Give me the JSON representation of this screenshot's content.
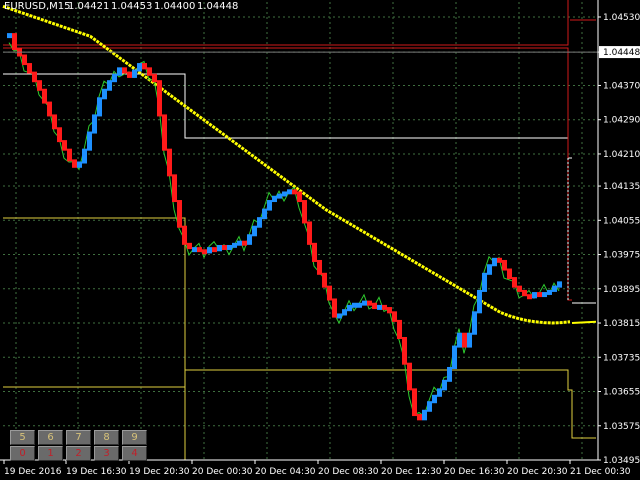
{
  "title": {
    "symbol_tf": "EURUSD,M15",
    "bid": "1.04421",
    "high": "1.04453",
    "low": "1.04400",
    "close": "1.04448"
  },
  "price_scale": {
    "ticks": [
      "1.04530",
      "1.04448",
      "1.04370",
      "1.04290",
      "1.04210",
      "1.04135",
      "1.04055",
      "1.03975",
      "1.03895",
      "1.03815",
      "1.03735",
      "1.03655",
      "1.03575",
      "1.03495"
    ],
    "current_price": "1.04448",
    "current_price_color": "#ffffff"
  },
  "time_scale": {
    "ticks": [
      "19 Dec 2016",
      "19 Dec 16:30",
      "19 Dec 20:30",
      "20 Dec 00:30",
      "20 Dec 04:30",
      "20 Dec 08:30",
      "20 Dec 12:30",
      "20 Dec 16:30",
      "20 Dec 20:30",
      "21 Dec 00:30"
    ]
  },
  "colors": {
    "background": "#000000",
    "grid": "#3f6f3f",
    "up_candle": "#1e90ff",
    "down_candle": "#ff1a1a",
    "ma_slow": "#ffff00",
    "ma_fast": "#2ecc2e",
    "channel_white": "#ffffff",
    "channel_yellow": "#e0d040",
    "channel_red": "#d01a1a",
    "axis_text": "#ffffff"
  },
  "panel": {
    "top_row": [
      "5",
      "6",
      "7",
      "8",
      "9"
    ],
    "bottom_row": [
      "0",
      "1",
      "2",
      "3",
      "4"
    ]
  },
  "chart_data": {
    "type": "line",
    "x_start": "19 Dec 2016 13:00",
    "bar_period_minutes": 15,
    "ylim": [
      1.03495,
      1.04565
    ],
    "series": [
      {
        "x_start": "19 Dec 2016 13:00",
        "values": [
          1.0449,
          1.04455,
          1.0444,
          1.0442,
          1.044,
          1.0438,
          1.0436,
          1.0433,
          1.043,
          1.0427,
          1.0424,
          1.0422,
          1.04195,
          1.0418,
          1.0419,
          1.0422,
          1.0426,
          1.043,
          1.0434,
          1.0436,
          1.0438,
          1.04395,
          1.0441,
          1.044,
          1.0439,
          1.04405,
          1.0442,
          1.0441,
          1.04395,
          1.0438,
          1.043,
          1.0422,
          1.0416,
          1.041,
          1.0404,
          1.04,
          1.0399,
          1.0399,
          1.03985,
          1.0398,
          1.0399,
          1.03985,
          1.03995,
          1.0399,
          1.03995,
          1.04,
          1.04005,
          1.04,
          1.0402,
          1.0404,
          1.0406,
          1.0408,
          1.041,
          1.0411,
          1.04115,
          1.0412,
          1.04125,
          1.0412,
          1.041,
          1.0405,
          1.04,
          1.0396,
          1.0393,
          1.039,
          1.0387,
          1.0383,
          1.03835,
          1.03845,
          1.03855,
          1.0386,
          1.0386,
          1.03865,
          1.0386,
          1.0385,
          1.03855,
          1.0385,
          1.0384,
          1.0382,
          1.0378,
          1.0372,
          1.0366,
          1.036,
          1.0359,
          1.0361,
          1.0363,
          1.03645,
          1.0366,
          1.0368,
          1.0371,
          1.0376,
          1.0379,
          1.0376,
          1.0379,
          1.0384,
          1.0389,
          1.0393,
          1.0395,
          1.03965,
          1.0396,
          1.0394,
          1.0392,
          1.039,
          1.0389,
          1.0388,
          1.03875,
          1.03885,
          1.0388,
          1.03885,
          1.0389,
          1.039,
          1.0391
        ]
      },
      {
        "values": [
          1.04555,
          1.04548,
          1.04541,
          1.04534,
          1.04527,
          1.0452,
          1.04513,
          1.04506,
          1.04499,
          1.04492,
          1.04485,
          1.0447,
          1.04455,
          1.0444,
          1.04425,
          1.0441,
          1.04395,
          1.0438,
          1.04365,
          1.0435,
          1.04335,
          1.0432,
          1.04305,
          1.0429,
          1.04275,
          1.0426,
          1.04245,
          1.0423,
          1.04215,
          1.042,
          1.04185,
          1.0417,
          1.04155,
          1.0414,
          1.04125,
          1.0411,
          1.04095,
          1.0408,
          1.04068,
          1.04056,
          1.04044,
          1.04032,
          1.0402,
          1.04008,
          1.03996,
          1.03984,
          1.03972,
          1.0396,
          1.03948,
          1.03936,
          1.03924,
          1.03912,
          1.039,
          1.03888,
          1.03876,
          1.03864,
          1.03852,
          1.0384,
          1.03832,
          1.03826,
          1.03821,
          1.03818,
          1.03816,
          1.03815,
          1.03816,
          1.03818
        ]
      }
    ]
  }
}
